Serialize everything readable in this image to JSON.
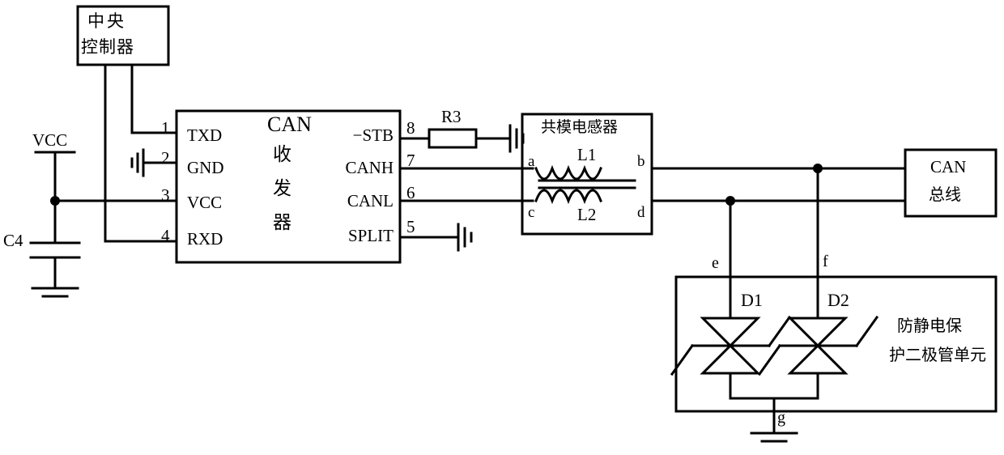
{
  "diagram": {
    "title": "CAN transceiver circuit with common mode inductor and ESD protection",
    "line_color": "#000000",
    "background": "#ffffff"
  },
  "blocks": {
    "controller": {
      "line1": "中央",
      "line2": "控制器"
    },
    "transceiver": {
      "title": "CAN",
      "line1": "收",
      "line2": "发",
      "line3": "器"
    },
    "common_mode_inductor": {
      "title": "共模电感器",
      "coil1": "L1",
      "coil2": "L2",
      "terminal_a": "a",
      "terminal_b": "b",
      "terminal_c": "c",
      "terminal_d": "d"
    },
    "can_bus": {
      "line1": "CAN",
      "line2": "总线"
    },
    "esd_unit": {
      "line1": "防静电保",
      "line2": "护二极管单元",
      "diode1": "D1",
      "diode2": "D2",
      "node_e": "e",
      "node_f": "f",
      "node_g": "g"
    }
  },
  "pins": {
    "left": [
      {
        "number": "1",
        "name": "TXD"
      },
      {
        "number": "2",
        "name": "GND"
      },
      {
        "number": "3",
        "name": "VCC"
      },
      {
        "number": "4",
        "name": "RXD"
      }
    ],
    "right": [
      {
        "number": "8",
        "name": "−STB"
      },
      {
        "number": "7",
        "name": "CANH"
      },
      {
        "number": "6",
        "name": "CANL"
      },
      {
        "number": "5",
        "name": "SPLIT"
      }
    ]
  },
  "components": {
    "resistor_r3": "R3",
    "capacitor_c4": "C4",
    "supply_vcc": "VCC"
  }
}
